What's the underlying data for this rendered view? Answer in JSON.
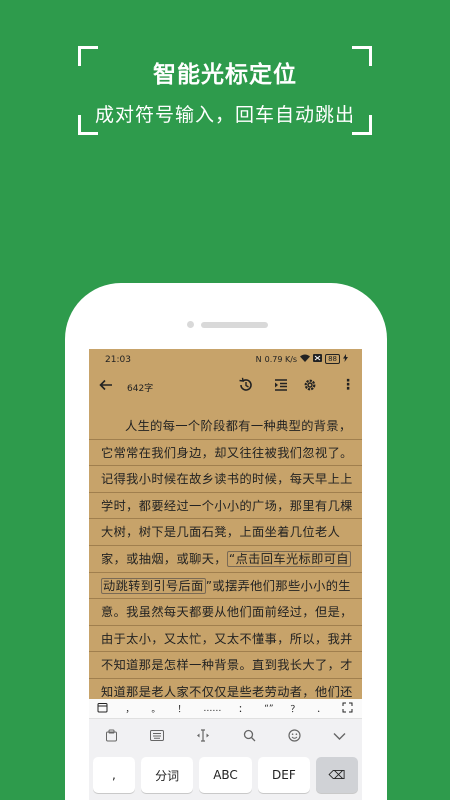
{
  "hero": {
    "title": "智能光标定位",
    "subtitle": "成对符号输入，回车自动跳出"
  },
  "status": {
    "time": "21:03",
    "net_speed": "0.79 K/s",
    "battery": "88"
  },
  "toolbar": {
    "back_icon": "arrow-left-icon",
    "word_count": "642字",
    "history_icon": "history-icon",
    "indent_icon": "indent-icon",
    "settings_icon": "gear-icon",
    "more_icon": "more-vertical-icon"
  },
  "content": {
    "lines": [
      "人生的每一个阶段都有一种典型的背景，",
      "它常常在我们身边，却又往往被我们忽视了。",
      "记得我小时候在故乡读书的时候，每天早上上",
      "学时，都要经过一个小小的广场，那里有几棵",
      "大树，树下是几面石凳，上面坐着几位老人",
      "家，或抽烟，或聊天，",
      "动跳转到引号后面",
      "意。我虽然每天都要从他们面前经过，但是，",
      "由于太小，又太忙，又太不懂事，所以，我并",
      "不知道那是怎样一种背景。直到我长大了，才",
      "知道那是老人家不仅仅是些老劳动者，他们还"
    ],
    "hl_part1": "“点击回车光标即可自",
    "hl_part2": "动跳转到引号后面",
    "after_hl": "”或摆弄他们那些小小的生"
  },
  "keyboard": {
    "symbols": [
      "，",
      "。",
      "！",
      "……",
      "：",
      "“”",
      "？",
      "．"
    ],
    "keys": [
      ",",
      "分词",
      "ABC",
      "DEF",
      "⌫"
    ]
  },
  "colors": {
    "background": "#2e9b4c",
    "paper": "#c7a36a"
  }
}
